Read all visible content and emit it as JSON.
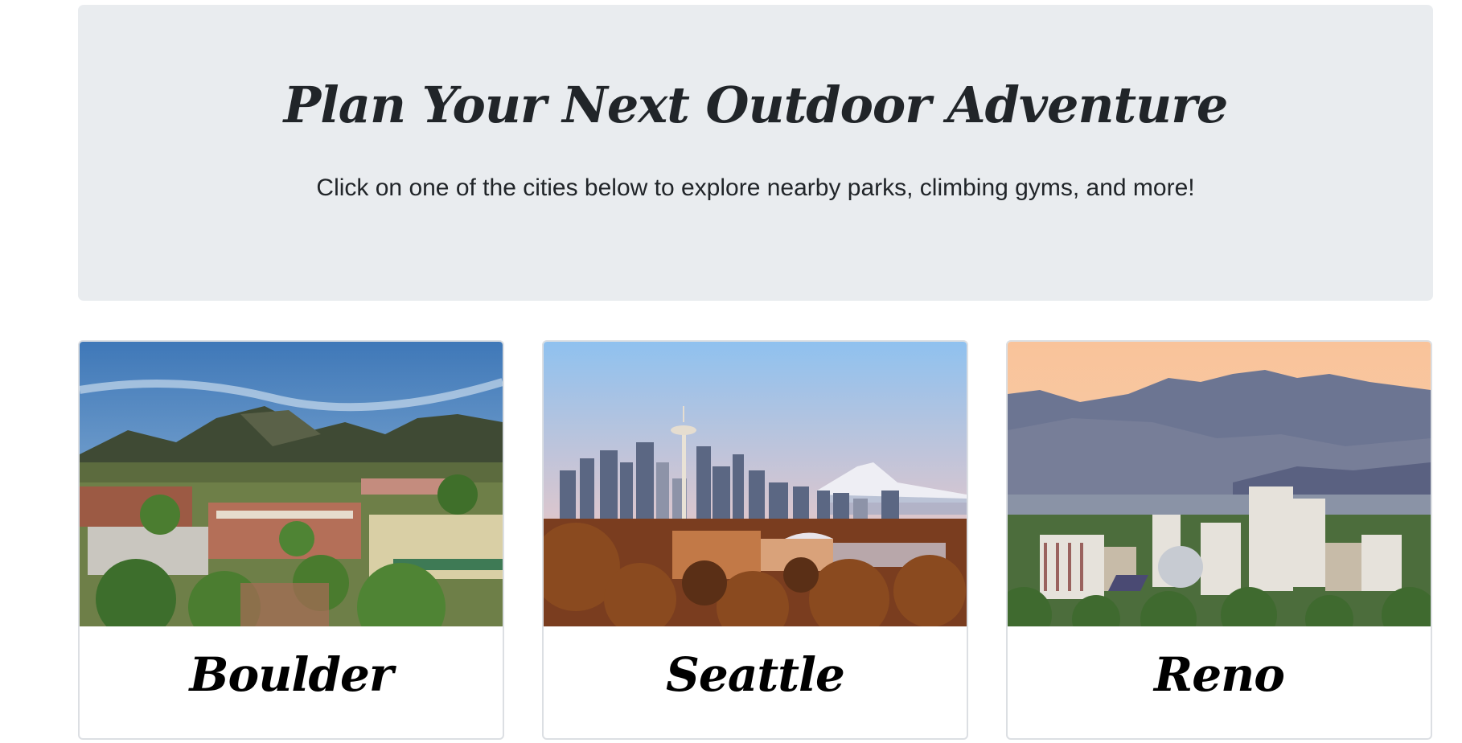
{
  "hero": {
    "title": "Plan Your Next Outdoor Adventure",
    "lead": "Click on one of the cities below to explore nearby parks, climbing gyms, and more!"
  },
  "cities": [
    {
      "name": "Boulder",
      "image_icon": "boulder-skyline-image"
    },
    {
      "name": "Seattle",
      "image_icon": "seattle-skyline-image"
    },
    {
      "name": "Reno",
      "image_icon": "reno-skyline-image"
    }
  ],
  "colors": {
    "hero_background": "#e9ecef",
    "text": "#212529",
    "card_border": "#dcdfe3"
  }
}
